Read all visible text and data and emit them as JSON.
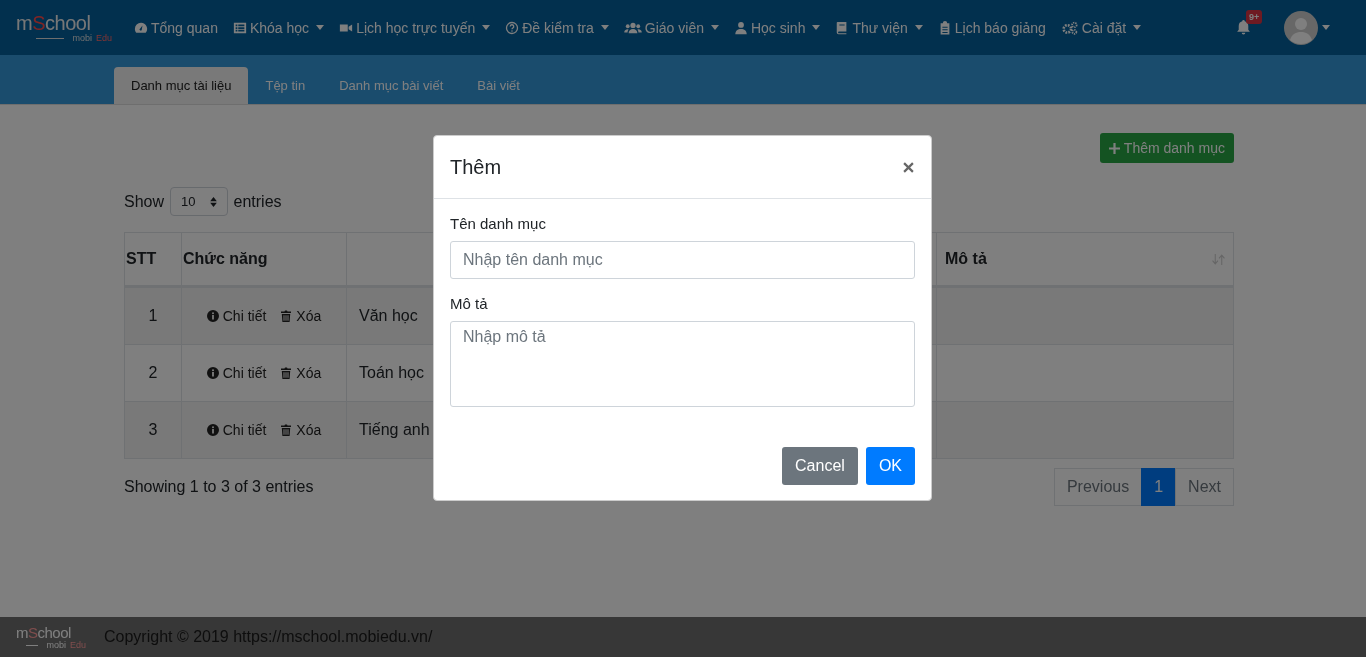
{
  "navbar": {
    "logo": {
      "prefix": "m",
      "accent": "S",
      "suffix": "chool",
      "sub_prefix": "mobi",
      "sub_accent": "Edu"
    },
    "items": [
      {
        "label": "Tổng quan",
        "kind": "gauge",
        "dropdown": false
      },
      {
        "label": "Khóa học",
        "kind": "list",
        "dropdown": true
      },
      {
        "label": "Lịch học trực tuyến",
        "kind": "video",
        "dropdown": true
      },
      {
        "label": "Đề kiểm tra",
        "kind": "question",
        "dropdown": true
      },
      {
        "label": "Giáo viên",
        "kind": "users",
        "dropdown": true
      },
      {
        "label": "Học sinh",
        "kind": "user",
        "dropdown": true
      },
      {
        "label": "Thư viện",
        "kind": "book",
        "dropdown": true
      },
      {
        "label": "Lịch báo giảng",
        "kind": "clipboard",
        "dropdown": false
      },
      {
        "label": "Cài đặt",
        "kind": "cogs",
        "dropdown": true
      }
    ],
    "notification_badge": "9+"
  },
  "tabs": [
    {
      "label": "Danh mục tài liệu",
      "selected": true
    },
    {
      "label": "Tệp tin",
      "selected": false
    },
    {
      "label": "Danh mục bài viết",
      "selected": false
    },
    {
      "label": "Bài viết",
      "selected": false
    }
  ],
  "add_button": "Thêm danh mục",
  "length_control": {
    "prefix": "Show",
    "value": "10",
    "suffix": "entries"
  },
  "table": {
    "columns": [
      {
        "label": "STT",
        "sortable": false
      },
      {
        "label": "Chức năng",
        "sortable": false
      },
      {
        "sortable": false
      },
      {
        "label": "Mô tả",
        "sortable": true
      }
    ],
    "rows": [
      {
        "stt": "1",
        "actions": [
          {
            "label": "Chi tiết",
            "kind": "detail"
          },
          {
            "label": "Xóa",
            "kind": "delete"
          }
        ],
        "name": "Văn học"
      },
      {
        "stt": "2",
        "actions": [
          {
            "label": "Chi tiết",
            "kind": "detail"
          },
          {
            "label": "Xóa",
            "kind": "delete"
          }
        ],
        "name": "Toán học"
      },
      {
        "stt": "3",
        "actions": [
          {
            "label": "Chi tiết",
            "kind": "detail"
          },
          {
            "label": "Xóa",
            "kind": "delete"
          }
        ],
        "name": "Tiếng anh"
      }
    ]
  },
  "info": "Showing 1 to 3 of 3 entries",
  "pagination": [
    {
      "label": "Previous",
      "disabled": true,
      "selected": false
    },
    {
      "label": "1",
      "disabled": false,
      "selected": true
    },
    {
      "label": "Next",
      "disabled": true,
      "selected": false
    }
  ],
  "footer": {
    "logo": {
      "prefix": "m",
      "accent": "S",
      "suffix": "chool",
      "sub_prefix": "mobi",
      "sub_accent": "Edu"
    },
    "copyright": "Copyright © 2019 https://mschool.mobiedu.vn/"
  },
  "modal": {
    "title": "Thêm",
    "fields": [
      {
        "label": "Tên danh mục",
        "kind": "input",
        "placeholder": "Nhập tên danh mục"
      },
      {
        "label": "Mô tả",
        "kind": "textarea",
        "placeholder": "Nhập mô tả"
      }
    ],
    "buttons": [
      {
        "label": "Cancel",
        "kind": "secondary"
      },
      {
        "label": "OK",
        "kind": "primary"
      }
    ]
  }
}
